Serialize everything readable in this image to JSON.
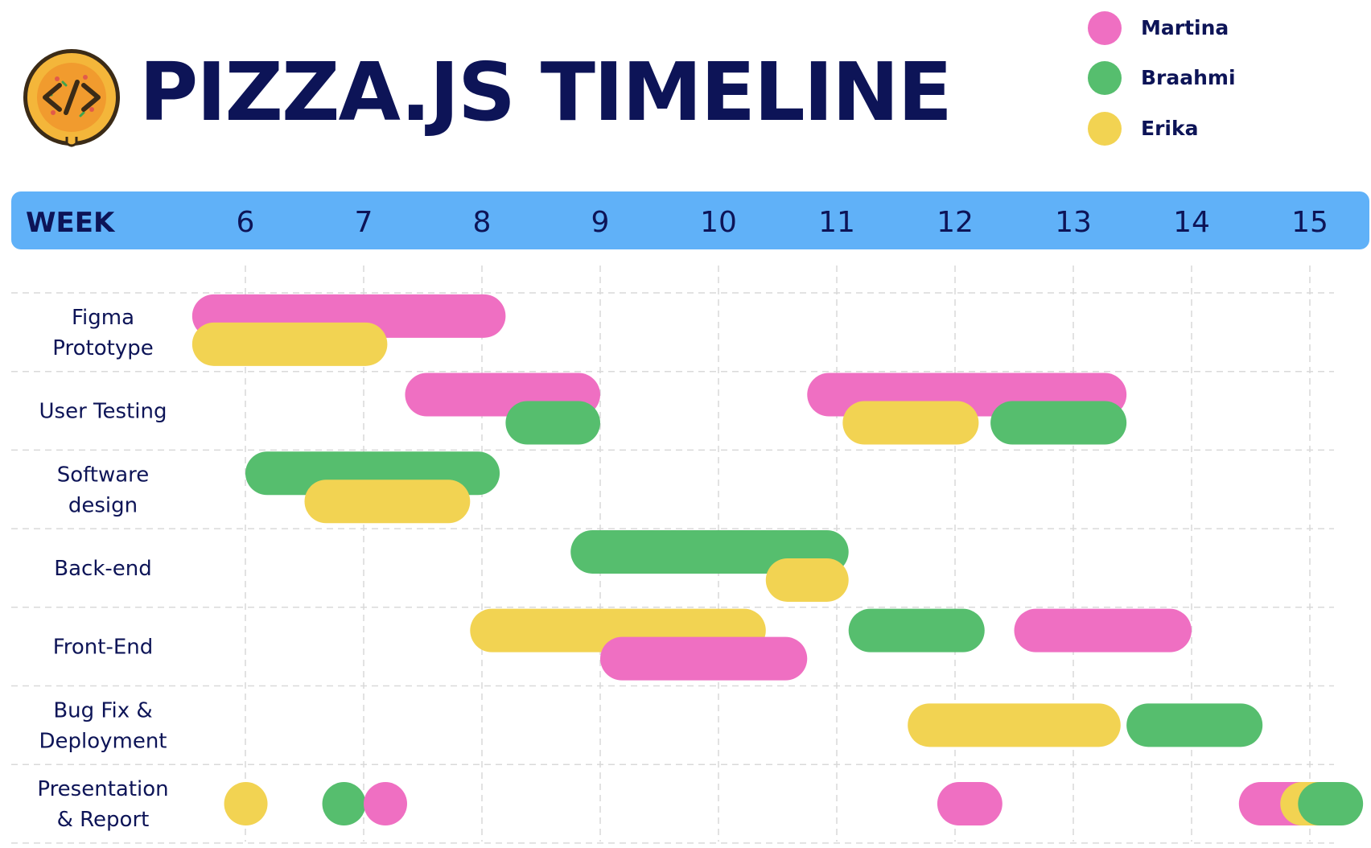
{
  "header": {
    "title": "PIZZA.JS TIMELINE"
  },
  "colors": {
    "Martina": "#ef6fc2",
    "Braahmi": "#56be6e",
    "Erika": "#f2d352",
    "navy": "#0d1457",
    "header_bar": "#60b1f8",
    "grid": "#d9d9d9",
    "logo_ring": "#3b2b17",
    "logo_crust": "#f4b63a",
    "logo_body": "#f19b2e"
  },
  "icons": {
    "logo": "pizza-code-icon"
  },
  "chart_data": {
    "type": "gantt",
    "title": "PIZZA.JS TIMELINE",
    "axis_label": "WEEK",
    "weeks": [
      6,
      7,
      8,
      9,
      10,
      11,
      12,
      13,
      14,
      15
    ],
    "xlim": [
      6,
      15
    ],
    "grid": true,
    "legend": {
      "placement": "top-right",
      "entries": [
        "Martina",
        "Braahmi",
        "Erika"
      ]
    },
    "tasks": [
      {
        "name": "Figma Prototype",
        "label_lines": [
          "Figma",
          "Prototype"
        ]
      },
      {
        "name": "User Testing",
        "label_lines": [
          "User Testing"
        ]
      },
      {
        "name": "Software design",
        "label_lines": [
          "Software",
          "design"
        ]
      },
      {
        "name": "Back-end",
        "label_lines": [
          "Back-end"
        ]
      },
      {
        "name": "Front-End",
        "label_lines": [
          "Front-End"
        ]
      },
      {
        "name": "Bug Fix & Deployment",
        "label_lines": [
          "Bug Fix &",
          "Deployment"
        ]
      },
      {
        "name": "Presentation & Report",
        "label_lines": [
          "Presentation",
          "& Report"
        ]
      }
    ],
    "bars": [
      {
        "task": 0,
        "person": "Martina",
        "start": 5.55,
        "end": 8.2,
        "lane": "top"
      },
      {
        "task": 0,
        "person": "Erika",
        "start": 5.55,
        "end": 7.2,
        "lane": "bottom"
      },
      {
        "task": 1,
        "person": "Martina",
        "start": 7.35,
        "end": 9.0,
        "lane": "top"
      },
      {
        "task": 1,
        "person": "Braahmi",
        "start": 8.2,
        "end": 9.0,
        "lane": "bottom"
      },
      {
        "task": 1,
        "person": "Martina",
        "start": 10.75,
        "end": 13.45,
        "lane": "top"
      },
      {
        "task": 1,
        "person": "Erika",
        "start": 11.05,
        "end": 12.2,
        "lane": "bottom"
      },
      {
        "task": 1,
        "person": "Braahmi",
        "start": 12.3,
        "end": 13.45,
        "lane": "bottom"
      },
      {
        "task": 2,
        "person": "Braahmi",
        "start": 6.0,
        "end": 8.15,
        "lane": "top"
      },
      {
        "task": 2,
        "person": "Erika",
        "start": 6.5,
        "end": 7.9,
        "lane": "bottom"
      },
      {
        "task": 3,
        "person": "Braahmi",
        "start": 8.75,
        "end": 11.1,
        "lane": "top"
      },
      {
        "task": 3,
        "person": "Erika",
        "start": 10.4,
        "end": 11.1,
        "lane": "bottom"
      },
      {
        "task": 4,
        "person": "Erika",
        "start": 7.9,
        "end": 10.4,
        "lane": "top"
      },
      {
        "task": 4,
        "person": "Martina",
        "start": 9.0,
        "end": 10.75,
        "lane": "bottom"
      },
      {
        "task": 4,
        "person": "Braahmi",
        "start": 11.1,
        "end": 12.25,
        "lane": "top"
      },
      {
        "task": 4,
        "person": "Martina",
        "start": 12.5,
        "end": 14.0,
        "lane": "top"
      },
      {
        "task": 5,
        "person": "Erika",
        "start": 11.6,
        "end": 13.4,
        "lane": "mid"
      },
      {
        "task": 5,
        "person": "Braahmi",
        "start": 13.45,
        "end": 14.6,
        "lane": "mid"
      },
      {
        "task": 6,
        "person": "Erika",
        "start": 5.82,
        "end": 6.18,
        "lane": "mid"
      },
      {
        "task": 6,
        "person": "Braahmi",
        "start": 6.65,
        "end": 7.0,
        "lane": "mid"
      },
      {
        "task": 6,
        "person": "Martina",
        "start": 7.0,
        "end": 7.35,
        "lane": "mid"
      },
      {
        "task": 6,
        "person": "Martina",
        "start": 11.85,
        "end": 12.4,
        "lane": "mid"
      },
      {
        "task": 6,
        "person": "Martina",
        "start": 14.4,
        "end": 15.2,
        "lane": "mid"
      },
      {
        "task": 6,
        "person": "Erika",
        "start": 14.75,
        "end": 15.3,
        "lane": "mid"
      },
      {
        "task": 6,
        "person": "Braahmi",
        "start": 14.9,
        "end": 15.45,
        "lane": "mid"
      }
    ]
  }
}
